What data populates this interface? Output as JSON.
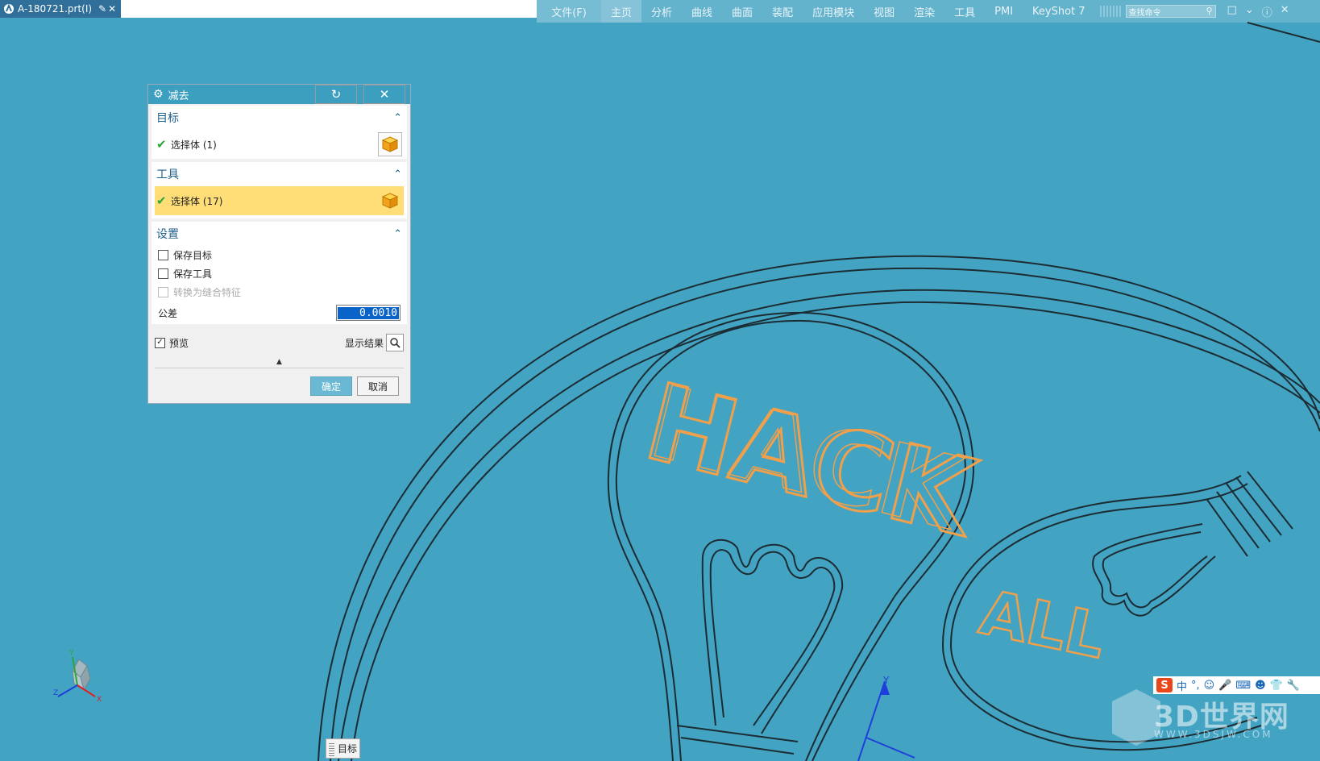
{
  "document_tab": {
    "title": "A-180721.prt(I)"
  },
  "ribbon": {
    "file_tab": "文件(F)",
    "tabs": [
      "主页",
      "分析",
      "曲线",
      "曲面",
      "装配",
      "应用模块",
      "视图",
      "渲染",
      "工具",
      "PMI",
      "KeyShot 7"
    ],
    "active_tab": "主页",
    "search_placeholder": "查找命令"
  },
  "dialog": {
    "title": "减去",
    "target_section": {
      "header": "目标",
      "select_label": "选择体 (1)"
    },
    "tool_section": {
      "header": "工具",
      "select_label": "选择体 (17)"
    },
    "settings_section": {
      "header": "设置",
      "keep_target": "保存目标",
      "keep_tool": "保存工具",
      "convert_to_sew": "转换为缝合特征",
      "tolerance_label": "公差",
      "tolerance_value": "0.0010"
    },
    "preview_label": "预览",
    "preview_checked": true,
    "show_result_label": "显示结果",
    "ok_label": "确定",
    "cancel_label": "取消"
  },
  "selection_tag": "目标",
  "viewport": {
    "text_hack": "HACK",
    "text_all": "ALL",
    "axis_y": "Y",
    "triad_y": "Y",
    "triad_z": "Z",
    "triad_x": "X",
    "background_color": "#43a3c2",
    "text_color": "#f0a04a"
  },
  "ime_bar": {
    "lang": "中"
  },
  "watermark": {
    "brand": "3D世界网",
    "url": "WWW.3DSJW.COM"
  }
}
